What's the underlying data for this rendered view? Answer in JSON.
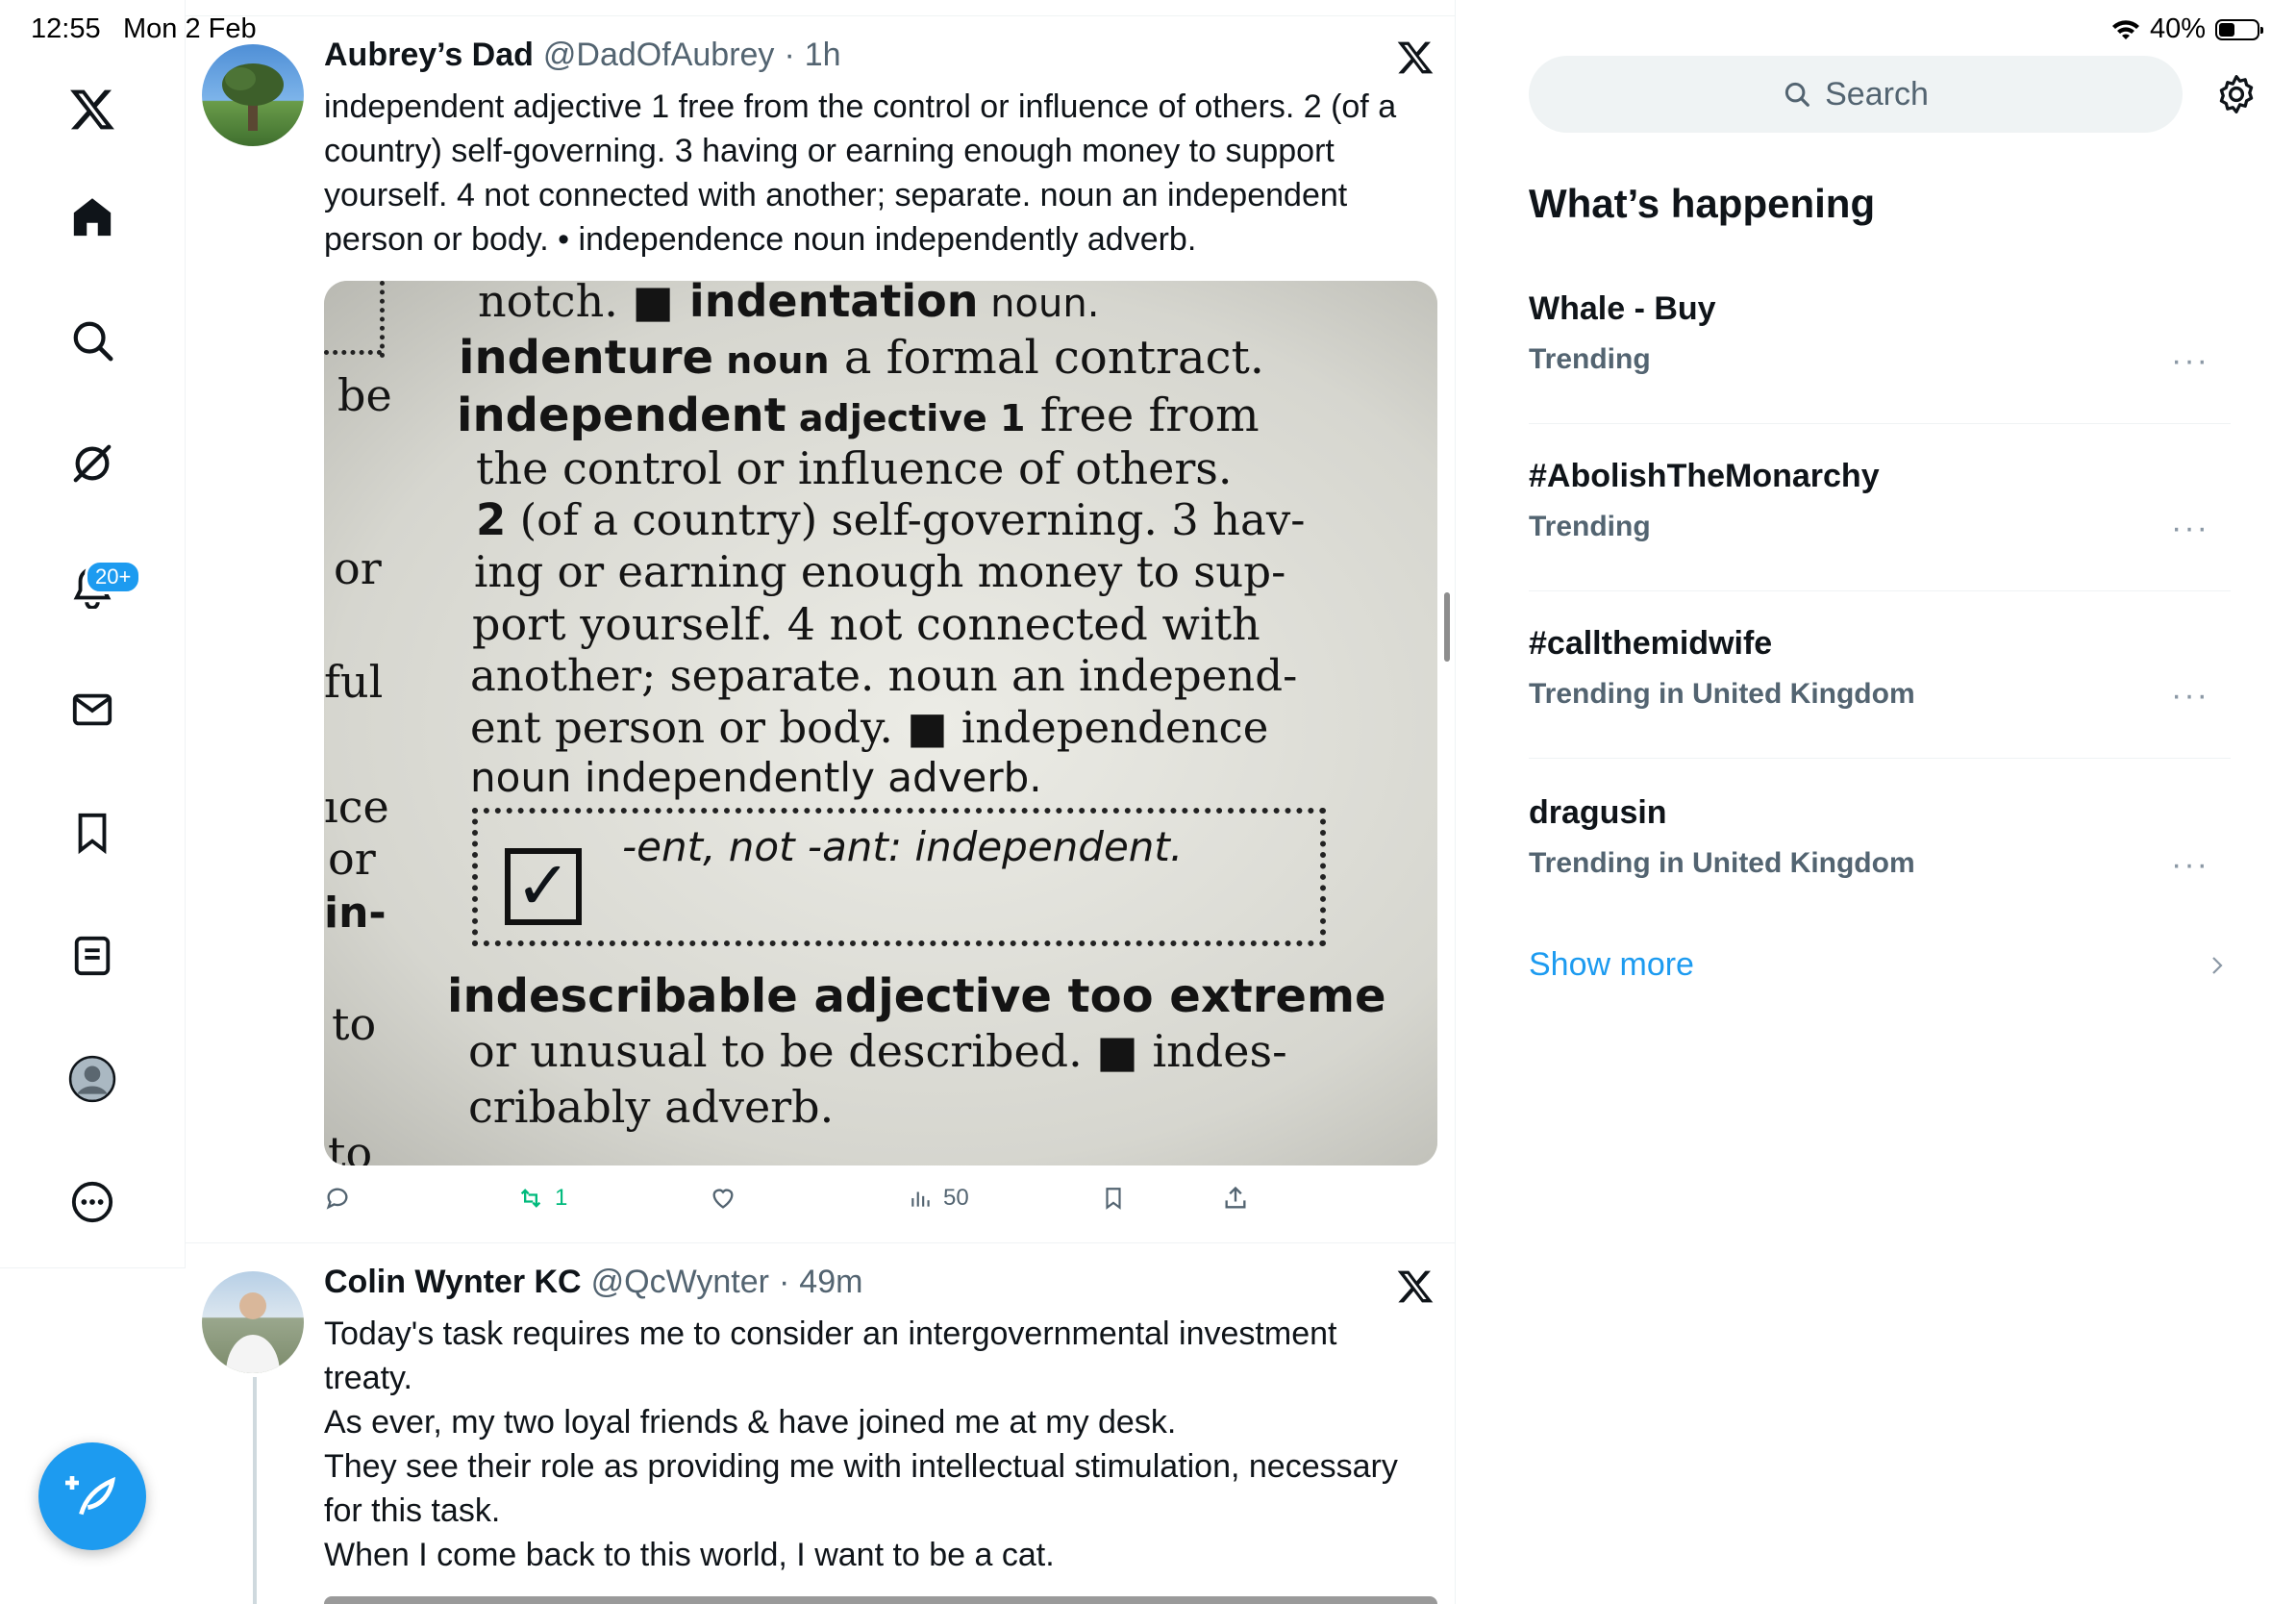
{
  "status_bar": {
    "time": "12:55",
    "date": "Mon 2 Feb",
    "battery": "40%"
  },
  "nav": {
    "notifications_badge": "20+"
  },
  "tweets": [
    {
      "name": "Aubrey’s Dad",
      "handle": "@DadOfAubrey",
      "dot": "·",
      "time": "1h",
      "text": "independent adjective 1 free from the control or influence of others. 2 (of a country) self-governing. 3 having or earning enough money to support yourself. 4 not connected with another; separate. noun an independent person or body. • independence noun independently adverb.",
      "actions": {
        "retweets": "1",
        "views": "50"
      },
      "media": {
        "left_margin": [
          "be",
          "or",
          "ful",
          "ıce",
          "or",
          "in-",
          "to",
          "to"
        ],
        "lines": [
          [
            "notch. ",
            "■ indentation",
            " noun."
          ],
          [
            "indenture",
            " noun",
            " a formal contract."
          ],
          [
            "independent",
            " adjective 1",
            " free from"
          ],
          [
            "",
            "",
            "the control or influence of others."
          ],
          [
            "2",
            "",
            " (of a country) self-governing. 3 hav-"
          ],
          [
            "",
            "",
            "ing or earning enough money to sup-"
          ],
          [
            "",
            "",
            "port yourself. 4 not connected with"
          ],
          [
            "",
            "",
            "another; separate. noun an independ-"
          ],
          [
            "",
            "",
            "ent person or body. ■ independence"
          ],
          [
            "",
            "",
            "noun independently adverb."
          ]
        ],
        "box_text": "-ent, not -ant: independent.",
        "after": [
          "indescribable adjective too extreme",
          "or unusual to be described. ■ indes-",
          "cribably adverb."
        ]
      }
    },
    {
      "name": "Colin Wynter KC",
      "handle": "@QcWynter",
      "dot": "·",
      "time": "49m",
      "text_lines": [
        "Today's task requires me to consider an intergovernmental investment",
        "treaty.",
        "As ever, my two loyal friends & have joined me at my desk.",
        "They see their role as providing me with intellectual stimulation, necessary",
        "for this task.",
        "When I come back to this world, I want to be a cat."
      ]
    }
  ],
  "sidebar": {
    "search_placeholder": "Search",
    "whats_happening": "What’s happening",
    "trends": [
      {
        "name": "Whale - Buy",
        "meta": "Trending"
      },
      {
        "name": "#AbolishTheMonarchy",
        "meta": "Trending"
      },
      {
        "name": "#callthemidwife",
        "meta": "Trending in United Kingdom"
      },
      {
        "name": "dragusin",
        "meta": "Trending in United Kingdom"
      }
    ],
    "show_more": "Show more",
    "more_glyph": "···"
  },
  "colors": {
    "accent": "#1d9bf0",
    "text_primary": "#0f1419",
    "text_secondary": "#536471",
    "retweet_green": "#00ba7c"
  }
}
